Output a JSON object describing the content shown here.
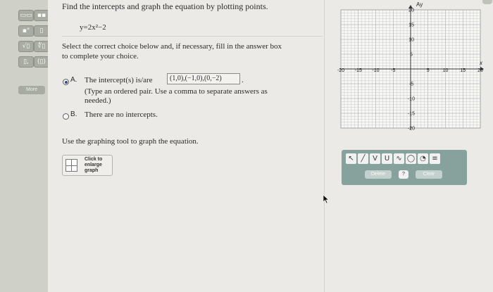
{
  "question": {
    "title": "Find the intercepts and graph the equation by plotting points.",
    "equation": "y=2x²−2",
    "instruction_line1": "Select the correct choice below and, if necessary, fill in the answer box",
    "instruction_line2": "to complete your choice."
  },
  "choices": {
    "a": {
      "letter": "A.",
      "label": "The intercept(s) is/are",
      "answer_value": "(1,0),(−1,0),(0,−2)",
      "period": ".",
      "hint_line1": "(Type an ordered pair. Use a comma to separate answers as",
      "hint_line2": "needed.)",
      "selected": true
    },
    "b": {
      "letter": "B.",
      "label": "There are no intercepts.",
      "selected": false
    }
  },
  "graph_instruction": "Use the graphing tool to graph the equation.",
  "enlarge_button": {
    "line1": "Click to",
    "line2": "enlarge",
    "line3": "graph"
  },
  "sidebar": {
    "more_label": "More",
    "tools": [
      "▭▭",
      "▪▪",
      "▪°",
      "▯",
      "√▯",
      "∜▯",
      "▯,",
      "(▯)"
    ]
  },
  "graph": {
    "y_axis_label": "Ay",
    "x_axis_label": "x",
    "x_ticks": [
      "-20",
      "-15",
      "-10",
      "-5",
      "5",
      "10",
      "15",
      "20"
    ],
    "y_ticks_positive": [
      "20",
      "15",
      "10",
      "5"
    ],
    "y_ticks_negative": [
      "-5",
      "-10",
      "-15",
      "-20"
    ],
    "xlim": [
      -20,
      20
    ],
    "ylim": [
      -20,
      20
    ]
  },
  "graph_tools": {
    "icons": [
      "↖",
      "╱",
      "V",
      "U",
      "∿",
      "◯",
      "◔",
      "≡"
    ],
    "icon_names": [
      "pointer-icon",
      "line-tool-icon",
      "absolute-value-tool-icon",
      "parabola-tool-icon",
      "curve-tool-icon",
      "circle-tool-icon",
      "ellipse-tool-icon",
      "menu-icon"
    ],
    "delete_label": "Delete",
    "help_label": "?",
    "clear_label": "Clear"
  }
}
